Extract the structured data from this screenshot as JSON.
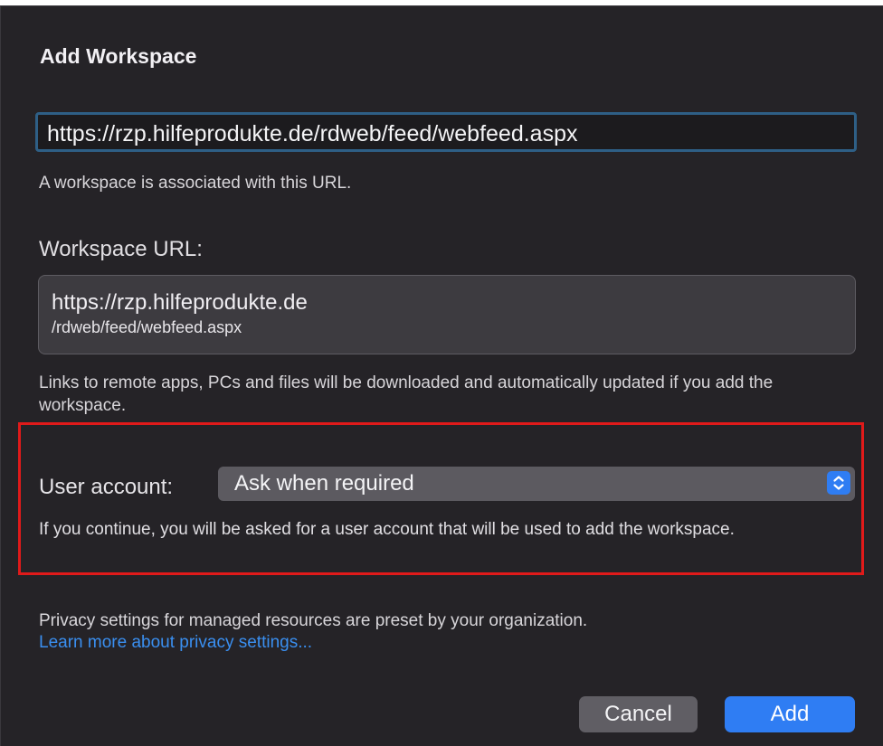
{
  "dialog": {
    "title": "Add Workspace",
    "url_input_value": "https://rzp.hilfeprodukte.de/rdweb/feed/webfeed.aspx",
    "url_status": "A workspace is associated with this URL.",
    "workspace_url_label": "Workspace URL:",
    "workspace_url_line1": "https://rzp.hilfeprodukte.de",
    "workspace_url_line2": "/rdweb/feed/webfeed.aspx",
    "download_note": "Links to remote apps, PCs and files will be downloaded and automatically updated if you add the workspace.",
    "user_account_label": "User account:",
    "user_account_value": "Ask when required",
    "user_account_note": "If you continue, you will be asked for a user account that will be used to add the workspace.",
    "privacy_note": "Privacy settings for managed resources are preset by your organization.",
    "privacy_link": "Learn more about privacy settings...",
    "cancel_label": "Cancel",
    "add_label": "Add"
  },
  "icons": {
    "select_arrows": "chevron-up-down-icon"
  },
  "colors": {
    "background": "#252327",
    "accent": "#2f7df3",
    "link": "#3a8ff0",
    "highlight_border": "#e01a1a"
  }
}
